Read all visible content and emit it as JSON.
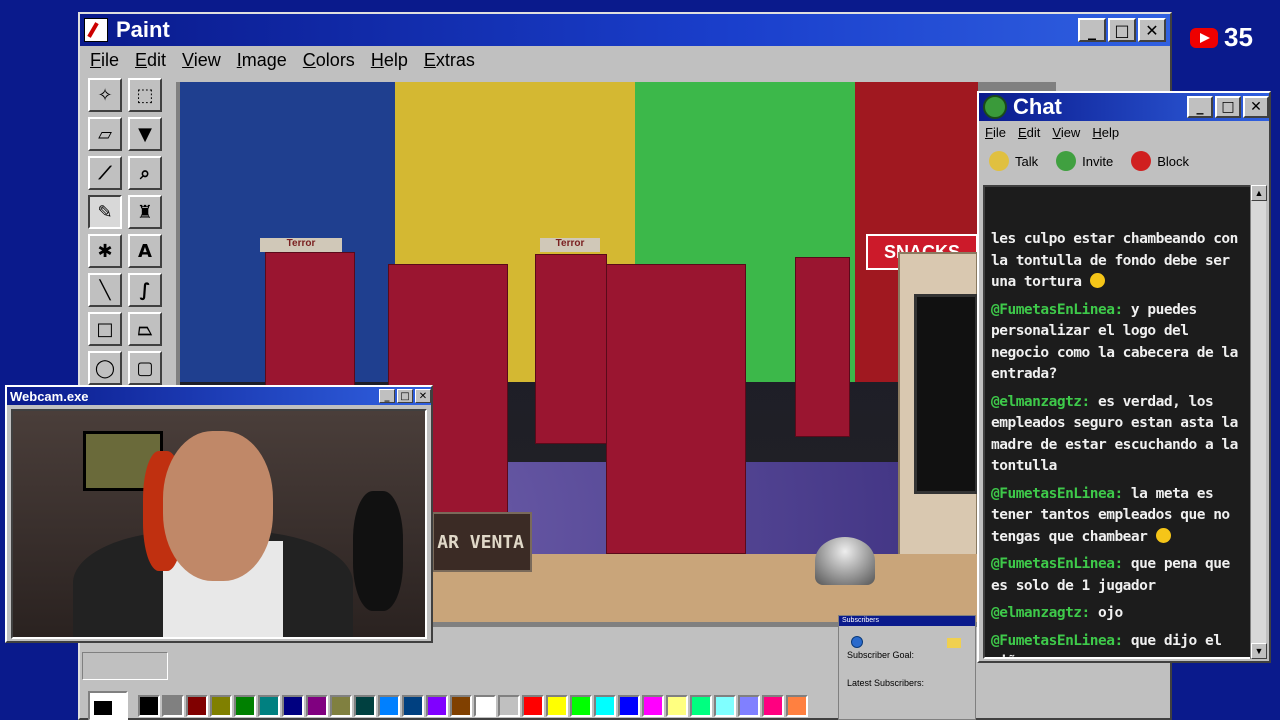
{
  "paint": {
    "title": "Paint",
    "menu": [
      "File",
      "Edit",
      "View",
      "Image",
      "Colors",
      "Help",
      "Extras"
    ],
    "tools": [
      {
        "name": "free-select-icon",
        "glyph": "✧"
      },
      {
        "name": "rect-select-icon",
        "glyph": "⬚"
      },
      {
        "name": "eraser-icon",
        "glyph": "▱"
      },
      {
        "name": "fill-icon",
        "glyph": "▼"
      },
      {
        "name": "color-picker-icon",
        "glyph": "⟋"
      },
      {
        "name": "magnifier-icon",
        "glyph": "⌕"
      },
      {
        "name": "pencil-icon",
        "glyph": "✎"
      },
      {
        "name": "brush-icon",
        "glyph": "♜"
      },
      {
        "name": "airbrush-icon",
        "glyph": "✱"
      },
      {
        "name": "text-icon",
        "glyph": "A"
      },
      {
        "name": "line-icon",
        "glyph": "╲"
      },
      {
        "name": "curve-icon",
        "glyph": "∫"
      },
      {
        "name": "rectangle-icon",
        "glyph": "□"
      },
      {
        "name": "polygon-icon",
        "glyph": "⏢"
      },
      {
        "name": "ellipse-icon",
        "glyph": "◯"
      },
      {
        "name": "rounded-rect-icon",
        "glyph": "▢"
      }
    ],
    "palette": [
      "#000000",
      "#808080",
      "#800000",
      "#808000",
      "#008000",
      "#008080",
      "#000080",
      "#800080",
      "#808040",
      "#004040",
      "#0080ff",
      "#004080",
      "#8000ff",
      "#804000",
      "#ffffff",
      "#c0c0c0",
      "#ff0000",
      "#ffff00",
      "#00ff00",
      "#00ffff",
      "#0000ff",
      "#ff00ff",
      "#ffff80",
      "#00ff80",
      "#80ffff",
      "#8080ff",
      "#ff0080",
      "#ff8040"
    ]
  },
  "game": {
    "shelf_label_1": "Terror",
    "shelf_label_2": "Terror",
    "snacks_sign": "SNACKS",
    "sell_button": "AR VENTA"
  },
  "webcam": {
    "title": "Webcam.exe"
  },
  "chat": {
    "title": "Chat",
    "menu": [
      "File",
      "Edit",
      "View",
      "Help"
    ],
    "tools": {
      "talk": "Talk",
      "invite": "Invite",
      "block": "Block"
    },
    "messages": [
      {
        "user": "",
        "text": "les culpo estar chambeando con la tontulla de fondo debe ser una tortura",
        "emoji": true
      },
      {
        "user": "@FumetasEnLinea:",
        "text": " y puedes personalizar el logo del negocio como la cabecera de la entrada?",
        "emoji": false
      },
      {
        "user": "@elmanzagtz:",
        "text": " es verdad, los empleados seguro estan asta la madre de estar escuchando a la tontulla",
        "emoji": false
      },
      {
        "user": "@FumetasEnLinea:",
        "text": " la meta es tener tantos empleados que no tengas que chambear",
        "emoji": true
      },
      {
        "user": "@FumetasEnLinea:",
        "text": " que pena que es solo de 1 jugador",
        "emoji": false
      },
      {
        "user": "@elmanzagtz:",
        "text": " ojo",
        "emoji": false
      },
      {
        "user": "@FumetasEnLinea:",
        "text": " que dijo el niño",
        "emoji": false
      }
    ]
  },
  "subscribers": {
    "title": "Subscribers",
    "goal_label": "Subscriber Goal:",
    "latest_label": "Latest Subscribers:"
  },
  "youtube": {
    "count": "35",
    "accent": "#ee0000"
  }
}
